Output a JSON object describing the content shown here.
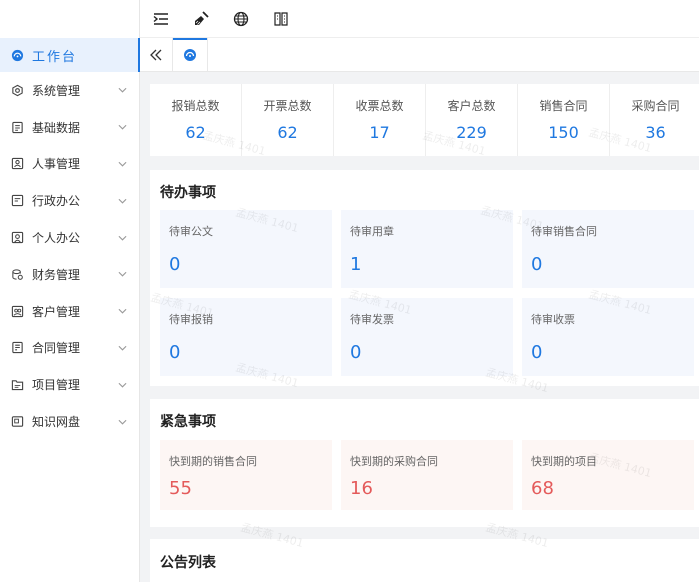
{
  "sidebar": {
    "items": [
      {
        "label": "工作台",
        "icon": "dashboard-icon"
      },
      {
        "label": "系统管理",
        "icon": "system-settings-icon"
      },
      {
        "label": "基础数据",
        "icon": "base-data-icon"
      },
      {
        "label": "人事管理",
        "icon": "personnel-icon"
      },
      {
        "label": "行政办公",
        "icon": "admin-office-icon"
      },
      {
        "label": "个人办公",
        "icon": "personal-office-icon"
      },
      {
        "label": "财务管理",
        "icon": "finance-icon"
      },
      {
        "label": "客户管理",
        "icon": "customer-icon"
      },
      {
        "label": "合同管理",
        "icon": "contract-icon"
      },
      {
        "label": "项目管理",
        "icon": "project-icon"
      },
      {
        "label": "知识网盘",
        "icon": "knowledge-disk-icon"
      }
    ]
  },
  "stats": [
    {
      "label": "报销总数",
      "value": "62"
    },
    {
      "label": "开票总数",
      "value": "62"
    },
    {
      "label": "收票总数",
      "value": "17"
    },
    {
      "label": "客户总数",
      "value": "229"
    },
    {
      "label": "销售合同",
      "value": "150"
    },
    {
      "label": "采购合同",
      "value": "36"
    }
  ],
  "todo": {
    "title": "待办事项",
    "items": [
      {
        "label": "待审公文",
        "value": "0"
      },
      {
        "label": "待审用章",
        "value": "1"
      },
      {
        "label": "待审销售合同",
        "value": "0"
      },
      {
        "label": "待审报销",
        "value": "0"
      },
      {
        "label": "待审发票",
        "value": "0"
      },
      {
        "label": "待审收票",
        "value": "0"
      }
    ]
  },
  "urgent": {
    "title": "紧急事项",
    "items": [
      {
        "label": "快到期的销售合同",
        "value": "55"
      },
      {
        "label": "快到期的采购合同",
        "value": "16"
      },
      {
        "label": "快到期的项目",
        "value": "68"
      }
    ]
  },
  "notice": {
    "title": "公告列表"
  },
  "watermark": "孟庆燕 1401",
  "colors": {
    "accent": "#1f78e0",
    "urgent": "#e45a5a"
  }
}
